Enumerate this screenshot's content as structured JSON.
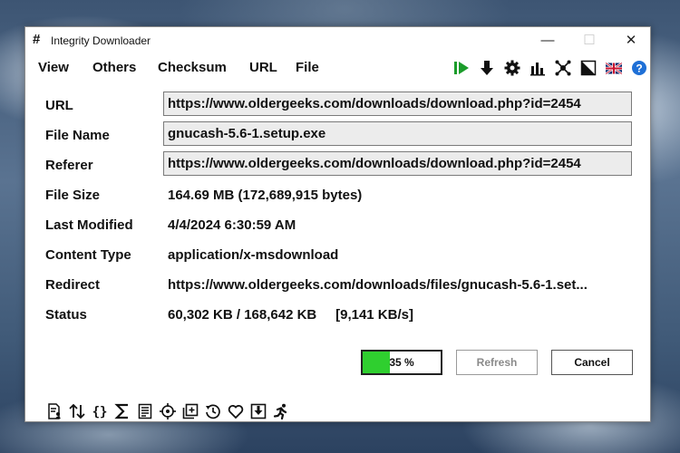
{
  "window": {
    "title": "Integrity Downloader",
    "app_icon": "#"
  },
  "window_controls": {
    "minimize": "—",
    "maximize": "☐",
    "close": "✕"
  },
  "menu": [
    "View",
    "Others",
    "Checksum",
    "URL",
    "File"
  ],
  "toolbar_icons": [
    "play-icon",
    "download-icon",
    "gear-icon",
    "bar-chart-icon",
    "network-icon",
    "contrast-icon",
    "uk-flag-icon",
    "help-icon"
  ],
  "fields": {
    "url": {
      "label": "URL",
      "value": "https://www.oldergeeks.com/downloads/download.php?id=2454"
    },
    "file_name": {
      "label": "File Name",
      "value": "gnucash-5.6-1.setup.exe"
    },
    "referer": {
      "label": "Referer",
      "value": "https://www.oldergeeks.com/downloads/download.php?id=2454"
    },
    "file_size": {
      "label": "File Size",
      "value": "164.69 MB (172,689,915 bytes)"
    },
    "last_modified": {
      "label": "Last Modified",
      "value": "4/4/2024 6:30:59 AM"
    },
    "content_type": {
      "label": "Content Type",
      "value": "application/x-msdownload"
    },
    "redirect": {
      "label": "Redirect",
      "value": "https://www.oldergeeks.com/downloads/files/gnucash-5.6-1.set..."
    },
    "status": {
      "label": "Status",
      "value": "60,302 KB / 168,642 KB     [9,141 KB/s]"
    }
  },
  "progress": {
    "percent": 35,
    "label": "35 %"
  },
  "buttons": {
    "refresh": "Refresh",
    "cancel": "Cancel"
  },
  "bottom_icons": [
    "document-user-icon",
    "sort-arrows-icon",
    "braces-icon",
    "sigma-icon",
    "list-document-icon",
    "target-icon",
    "add-box-icon",
    "history-icon",
    "heart-icon",
    "save-icon",
    "run-icon"
  ],
  "colors": {
    "accent_green": "#2fcf2f",
    "play_green": "#1a9c2a",
    "help_blue": "#1e6fd6"
  }
}
